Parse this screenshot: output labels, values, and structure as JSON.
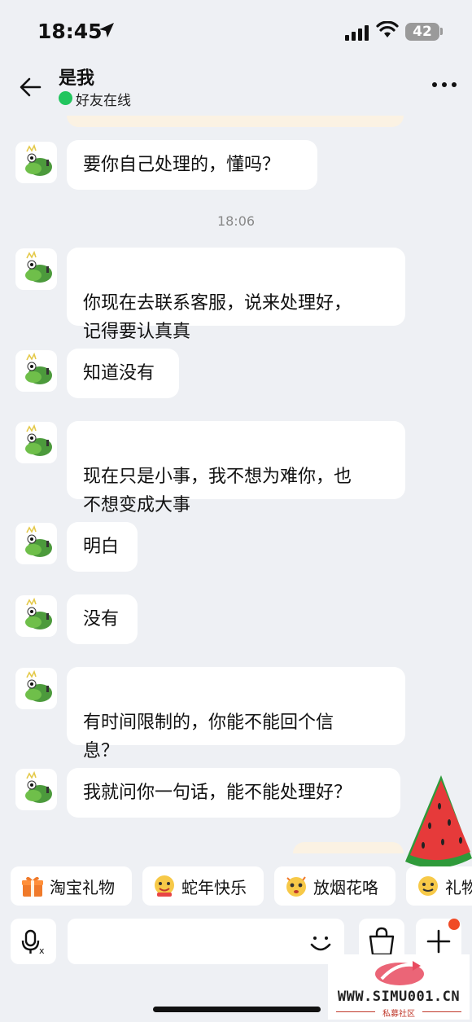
{
  "status": {
    "time": "18:45",
    "battery": "42"
  },
  "header": {
    "name": "是我",
    "presence": "好友在线"
  },
  "messages": [
    {
      "text": "要你自己处理的，懂吗？"
    },
    {
      "text": "你现在去联系客服，说来处理好，\n记得要认真真"
    },
    {
      "text": "知道没有"
    },
    {
      "text": "现在只是小事，我不想为难你，也\n不想变成大事"
    },
    {
      "text": "明白"
    },
    {
      "text": "没有"
    },
    {
      "text": "有时间限制的，你能不能回个信\n息？"
    },
    {
      "text": "我就问你一句话，能不能处理好？"
    }
  ],
  "time_separator": "18:06",
  "quick_replies": [
    {
      "label": "淘宝礼物",
      "icon": "gift-icon"
    },
    {
      "label": "蛇年快乐",
      "icon": "snake-emoji-icon"
    },
    {
      "label": "放烟花咯",
      "icon": "fireworks-emoji-icon"
    },
    {
      "label": "礼物",
      "icon": "gift-emoji-icon"
    }
  ],
  "input": {
    "placeholder": ""
  },
  "watermark": {
    "url": "WWW.SIMU001.CN",
    "sub": "私募社区"
  },
  "colors": {
    "online": "#22c55e",
    "badge": "#f04a25",
    "background": "#eef0f4"
  }
}
